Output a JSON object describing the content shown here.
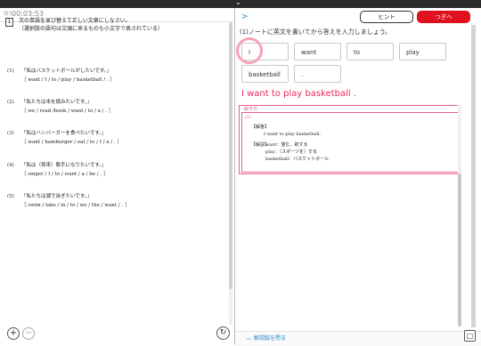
{
  "window": {
    "collapse_chevron": "⌄"
  },
  "timer": {
    "label": "残り",
    "value": "00:03:53"
  },
  "left": {
    "question_number": "1",
    "instructions": [
      "次の単語を並び替えて正しい文章にしなさい。",
      "（選択肢の語句は文頭に来るものも小文字で表されている）"
    ],
    "questions": [
      {
        "num": "(1)",
        "jp": "「私はバスケットボールがしたいです。」",
        "en": "［ want / I / to / play / basketball / . ］"
      },
      {
        "num": "(2)",
        "jp": "「私たちは本を読みたいです。」",
        "en": "［ we / read /book / want / to / a / . ］"
      },
      {
        "num": "(3)",
        "jp": "「私はハンバーガーを食べたいです。」",
        "en": "［ want / hamburger / eat / to / I / a / . ］"
      },
      {
        "num": "(4)",
        "jp": "「私は（将来）歌手になりたいです。」",
        "en": "［ singer / I / to / want / a / be / . ］"
      },
      {
        "num": "(5)",
        "jp": "「私たちは湖で泳ぎたいです。」",
        "en": "［ swim / lake / in / to / we / the / want / . ］"
      }
    ],
    "zoom_in": "+",
    "zoom_out": "−",
    "refresh": "↻"
  },
  "right": {
    "nav_arrow": ">",
    "hint_button": "ヒント",
    "next_button": "つぎへ",
    "question_instruction": "(1)ノートに英文を書いてから答えを入力しましょう。",
    "chips": [
      {
        "label": "I"
      },
      {
        "label": "want"
      },
      {
        "label": "to"
      },
      {
        "label": "play"
      },
      {
        "label": "basketball"
      },
      {
        "label": "."
      }
    ],
    "answer_sentence": "I want to play basketball .",
    "explanation": {
      "label": "解き方",
      "item_number": "(1)",
      "answer_heading": "【解答】",
      "answer_text": "I want to play basketball.",
      "commentary_heading": "【解説】",
      "commentary_lines": [
        "want：望む、欲する",
        "play：（スポーツを）する",
        "basketball：バスケットボール"
      ]
    },
    "close_explanation": "解説脇を閉る",
    "close_caret": "︿",
    "dock_button": "□"
  },
  "colors": {
    "accent_red": "#e0101e",
    "answer_pink": "#e8295d",
    "link_blue": "#1e88c8"
  }
}
